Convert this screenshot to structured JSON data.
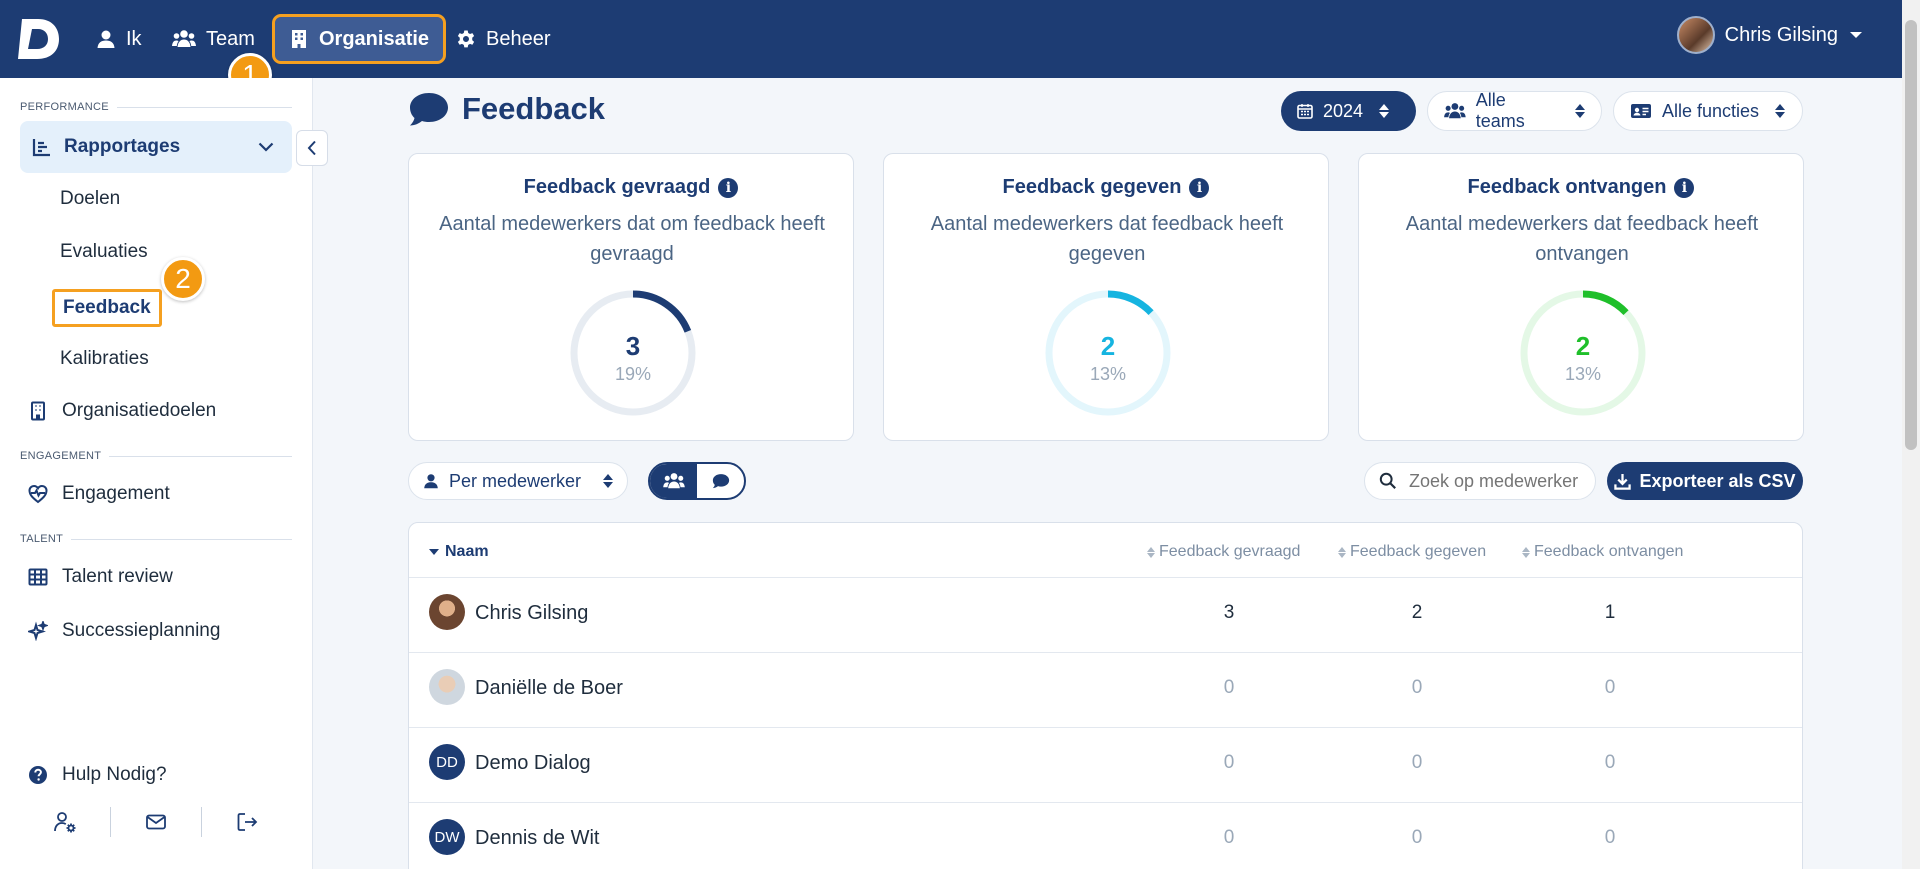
{
  "nav": {
    "items": [
      {
        "label": "Ik",
        "icon": "user-icon"
      },
      {
        "label": "Team",
        "icon": "users-icon"
      },
      {
        "label": "Organisatie",
        "icon": "building-icon"
      },
      {
        "label": "Beheer",
        "icon": "gear-icon"
      }
    ],
    "active_index": 2,
    "user_name": "Chris Gilsing"
  },
  "steps": [
    "1",
    "2"
  ],
  "sidebar": {
    "sections": [
      "PERFORMANCE",
      "ENGAGEMENT",
      "TALENT"
    ],
    "group_label": "Rapportages",
    "sub_items": [
      "Doelen",
      "Evaluaties",
      "Feedback",
      "Kalibraties"
    ],
    "active_sub": "Feedback",
    "items": [
      "Organisatiedoelen",
      "Engagement",
      "Talent review",
      "Successieplanning"
    ],
    "help_label": "Hulp Nodig?"
  },
  "page": {
    "title": "Feedback",
    "filters": {
      "year": "2024",
      "teams": "Alle teams",
      "functions": "Alle functies"
    }
  },
  "cards": [
    {
      "title": "Feedback gevraagd",
      "subtitle": "Aantal medewerkers dat om feedback heeft gevraagd",
      "count": "3",
      "percent": "19%",
      "fraction": 0.19,
      "color": "#1d3c73",
      "track": "#e7ecf2"
    },
    {
      "title": "Feedback gegeven",
      "subtitle": "Aantal medewerkers dat feedback heeft gegeven",
      "count": "2",
      "percent": "13%",
      "fraction": 0.13,
      "color": "#16b4e0",
      "track": "#e3f6fc"
    },
    {
      "title": "Feedback ontvangen",
      "subtitle": "Aantal medewerkers dat feedback heeft ontvangen",
      "count": "2",
      "percent": "13%",
      "fraction": 0.13,
      "color": "#1fbf2a",
      "track": "#e4f8e6"
    }
  ],
  "toolbar": {
    "view_select": "Per medewerker",
    "search_placeholder": "Zoek op medewerker",
    "export_label": "Exporteer als CSV"
  },
  "table": {
    "columns": [
      "Naam",
      "Feedback gevraagd",
      "Feedback gegeven",
      "Feedback ontvangen"
    ],
    "rows": [
      {
        "name": "Chris Gilsing",
        "initials": "",
        "values": [
          "3",
          "2",
          "1"
        ]
      },
      {
        "name": "Daniëlle de Boer",
        "initials": "",
        "values": [
          "0",
          "0",
          "0"
        ]
      },
      {
        "name": "Demo Dialog",
        "initials": "DD",
        "values": [
          "0",
          "0",
          "0"
        ]
      },
      {
        "name": "Dennis de Wit",
        "initials": "DW",
        "values": [
          "0",
          "0",
          "0"
        ]
      }
    ]
  },
  "colors": {
    "brand": "#1d3c73",
    "highlight": "#f5a020",
    "step_badge": "#f39a12"
  }
}
